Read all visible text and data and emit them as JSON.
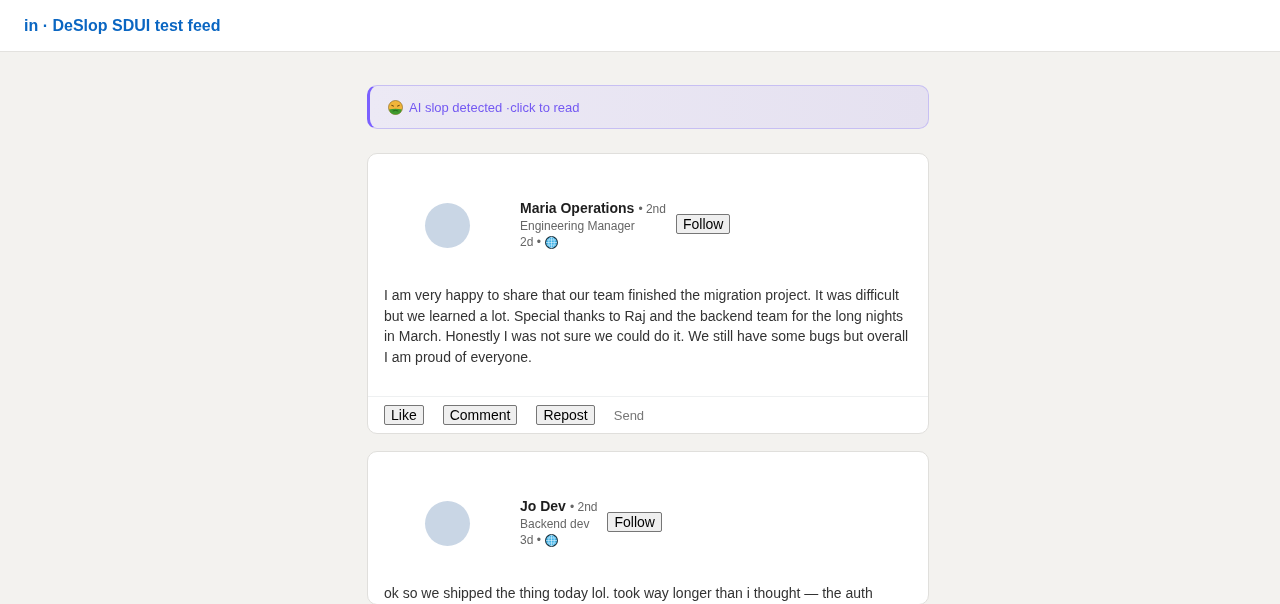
{
  "header": {
    "title": "in · DeSlop SDUI test feed"
  },
  "banner": {
    "text": "AI slop detected ·click to read"
  },
  "posts": [
    {
      "author": "Maria Operations",
      "degree": "• 2nd",
      "headline": "Engineering Manager",
      "time": "2d •",
      "follow": "Follow",
      "body": "I am very happy to share that our team finished the migration project. It was difficult but we learned a lot. Special thanks to Raj and the backend team for the long nights in March. Honestly I was not sure we could do it. We still have some bugs but overall I am proud of everyone.",
      "actions": [
        {
          "label": "Like",
          "kind": "button"
        },
        {
          "label": "Comment",
          "kind": "button"
        },
        {
          "label": "Repost",
          "kind": "button"
        },
        {
          "label": "Send",
          "kind": "link"
        }
      ]
    },
    {
      "author": "Jo Dev",
      "degree": "• 2nd",
      "headline": "Backend dev",
      "time": "3d •",
      "follow": "Follow",
      "body": "ok so we shipped the thing today lol. took way longer than i thought — the auth"
    }
  ]
}
